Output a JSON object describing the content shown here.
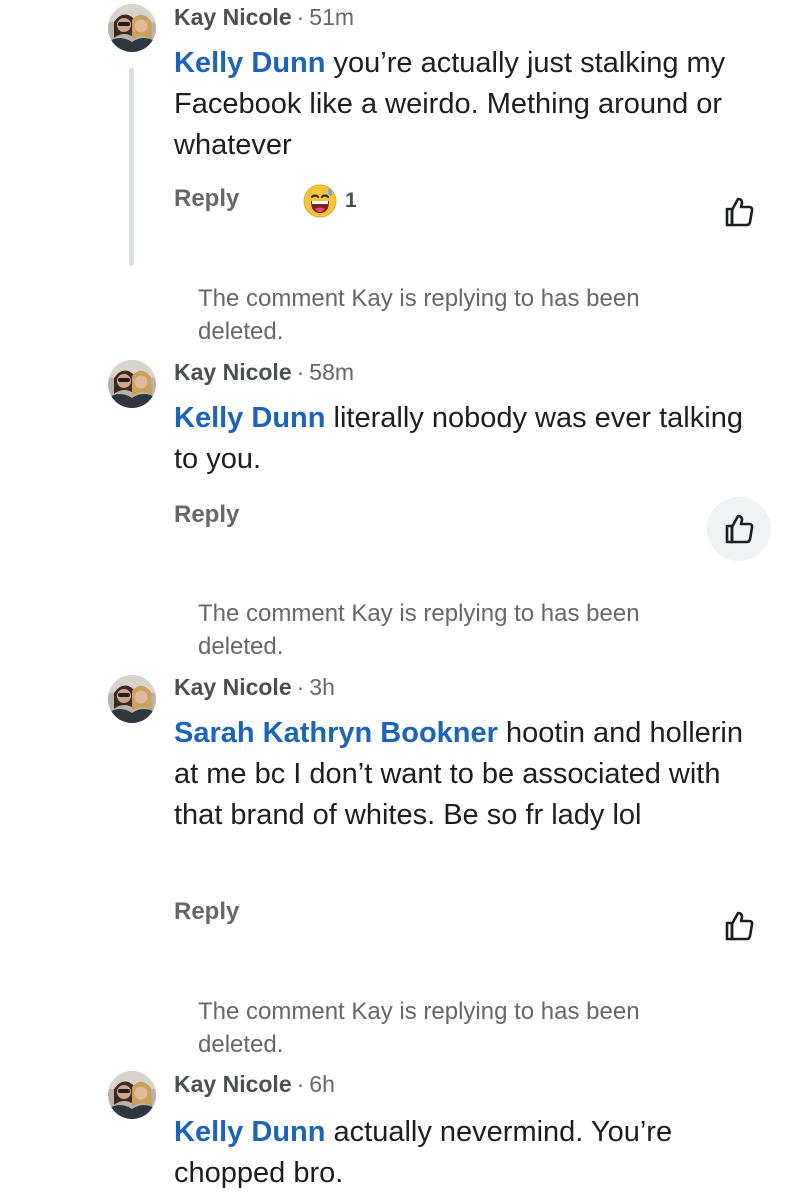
{
  "comments": [
    {
      "author": "Kay Nicole",
      "time": "51m",
      "mention": "Kelly Dunn",
      "text": " you’re actually just stalking my Facebook like a weirdo. Mething around or whatever",
      "reply_label": "Reply",
      "reaction": {
        "icon": "grinning-sweat-emoji-icon",
        "count": "1"
      }
    },
    {
      "deleted_notice": "The comment Kay is replying to has been deleted.",
      "author": "Kay Nicole",
      "time": "58m",
      "mention": "Kelly Dunn",
      "text": " literally nobody was ever talking to you.",
      "reply_label": "Reply"
    },
    {
      "deleted_notice": "The comment Kay is replying to has been deleted.",
      "author": "Kay Nicole",
      "time": "3h",
      "mention": "Sarah Kathryn Bookner",
      "text": " hootin and hollerin at me bc I don’t want to be associated with that brand of whites. Be so fr lady lol",
      "reply_label": "Reply"
    },
    {
      "deleted_notice": "The comment Kay is replying to has been deleted.",
      "author": "Kay Nicole",
      "time": "6h",
      "mention": "Kelly Dunn",
      "text": " actually nevermind. You’re chopped bro."
    }
  ],
  "colors": {
    "mention": "#1b64b8",
    "meta": "#65676b",
    "text": "#1c1e21",
    "thread_line": "#dadde1",
    "pressed_bg": "#f0f2f5"
  },
  "icons": {
    "like": "thumbs-up-icon",
    "avatar": "profile-photo-avatar"
  }
}
